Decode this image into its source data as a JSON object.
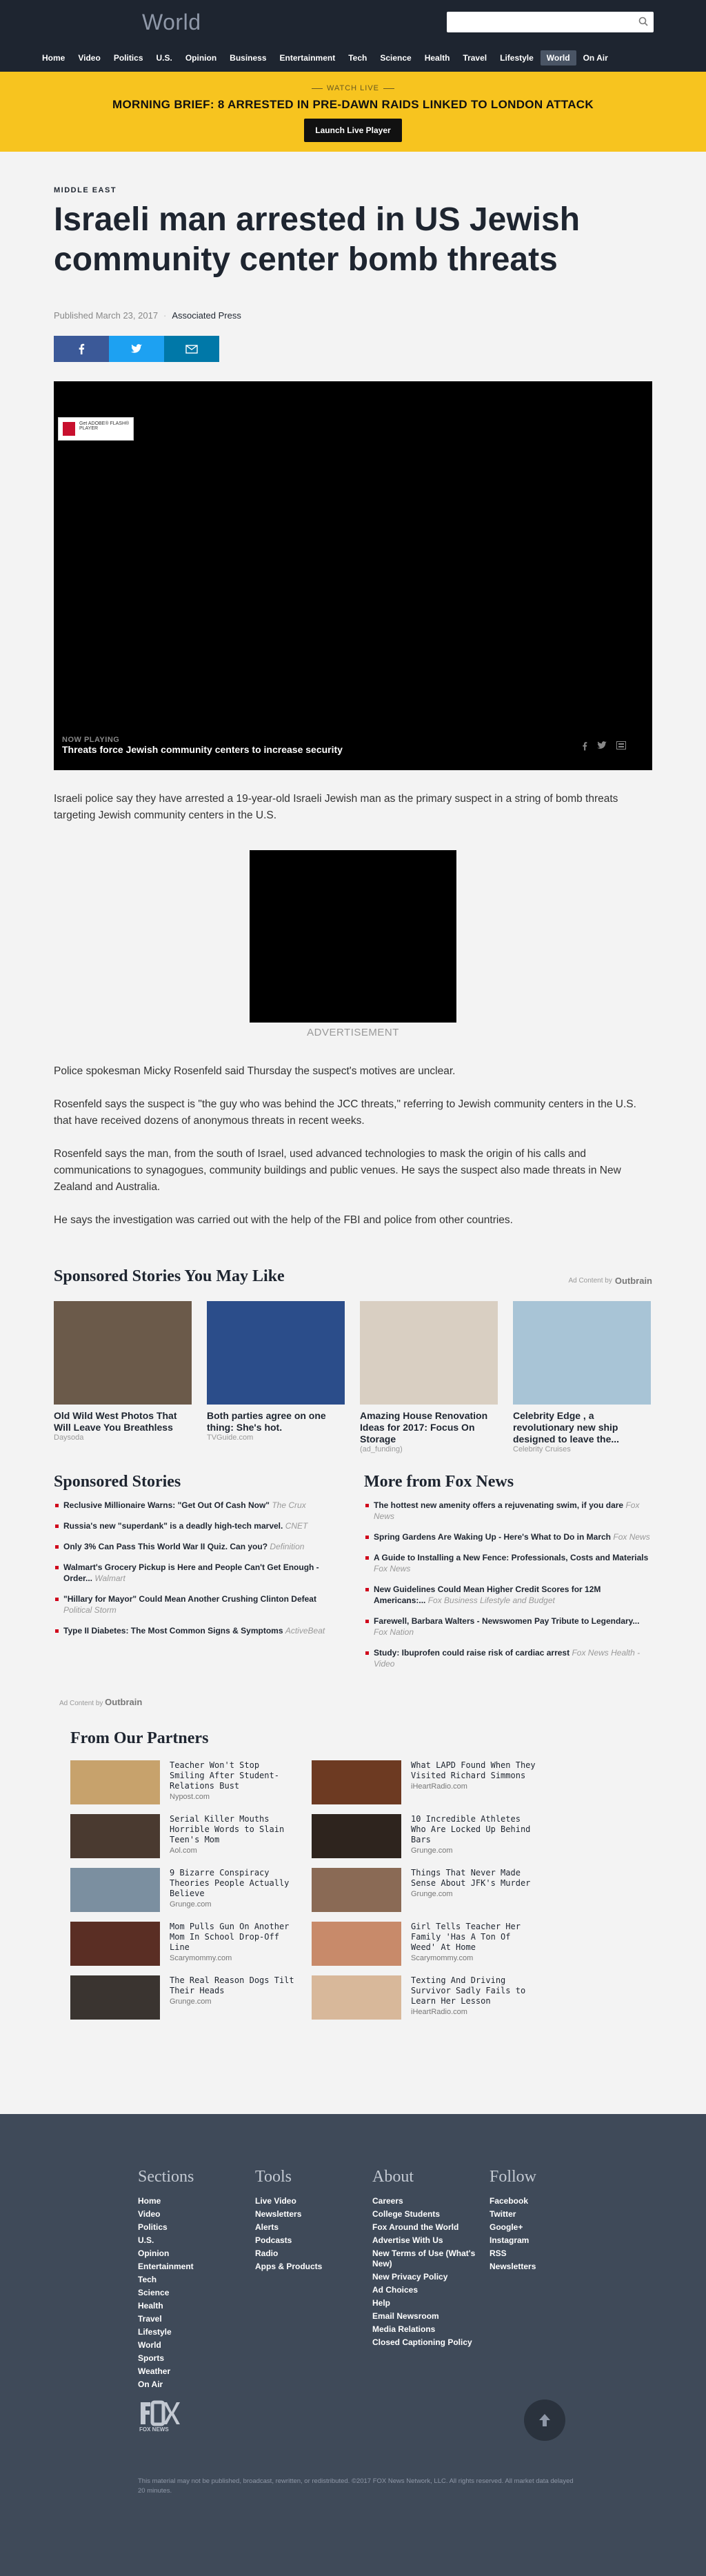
{
  "header": {
    "section_title": "World",
    "search_placeholder": "",
    "nav": [
      "Home",
      "Video",
      "Politics",
      "U.S.",
      "Opinion",
      "Business",
      "Entertainment",
      "Tech",
      "Science",
      "Health",
      "Travel",
      "Lifestyle",
      "World",
      "On Air"
    ],
    "active_nav": "World"
  },
  "watch_live": {
    "label": "WATCH LIVE",
    "headline": "MORNING BRIEF: 8 ARRESTED IN PRE-DAWN RAIDS LINKED TO LONDON ATTACK",
    "button": "Launch Live Player"
  },
  "article": {
    "kicker": "MIDDLE EAST",
    "headline": "Israeli man arrested in US Jewish community center bomb threats",
    "published": "Published March 23, 2017",
    "author": "Associated Press",
    "video": {
      "badge_text": "Get ADOBE® FLASH® PLAYER",
      "now_playing_label": "NOW PLAYING",
      "title": "Threats force Jewish community centers to increase security"
    },
    "paragraph_1": "Israeli police say they have arrested a 19-year-old Israeli Jewish man as the primary suspect in a string of bomb threats targeting Jewish community centers in the U.S.",
    "ad_label": "ADVERTISEMENT",
    "paragraph_2": "Police spokesman Micky Rosenfeld said Thursday the suspect's motives are unclear.",
    "paragraph_3": "Rosenfeld says the suspect is \"the guy who was behind the JCC threats,\" referring to Jewish community centers in the U.S. that have received dozens of anonymous threats in recent weeks.",
    "paragraph_4": "Rosenfeld says the man, from the south of Israel, used advanced technologies to mask the origin of his calls and communications to synagogues, community buildings and public venues. He says the suspect also made threats in New Zealand and Australia.",
    "paragraph_5": "He says the investigation was carried out with the help of the FBI and police from other countries."
  },
  "sponsored_grid": {
    "title": "Sponsored Stories You May Like",
    "ad_content": "Ad Content by",
    "outbrain": "Outbrain",
    "cards": [
      {
        "title": "Old Wild West Photos That Will Leave You Breathless",
        "source": "Daysoda",
        "color": "#6b5a4a"
      },
      {
        "title": "Both parties agree on one thing: She's hot.",
        "source": "TVGuide.com",
        "color": "#2b4d8a"
      },
      {
        "title": "Amazing House Renovation Ideas for 2017: Focus On Storage",
        "source": "(ad_funding)",
        "color": "#d9cfc2"
      },
      {
        "title": "Celebrity Edge , a revolutionary new ship designed to leave the...",
        "source": "Celebrity Cruises",
        "color": "#a8c4d6"
      }
    ]
  },
  "sponsored_list": {
    "title": "Sponsored Stories",
    "items": [
      {
        "text": "Reclusive Millionaire Warns: \"Get Out Of Cash Now\"",
        "source": "The Crux"
      },
      {
        "text": "Russia's new \"superdank\" is a deadly high-tech marvel.",
        "source": "CNET"
      },
      {
        "text": "Only 3% Can Pass This World War II Quiz. Can you?",
        "source": "Definition"
      },
      {
        "text": "Walmart's Grocery Pickup is Here and People Can't Get Enough - Order...",
        "source": "Walmart"
      },
      {
        "text": "\"Hillary for Mayor\" Could Mean Another Crushing Clinton Defeat",
        "source": "Political Storm"
      },
      {
        "text": "Type II Diabetes: The Most Common Signs & Symptoms",
        "source": "ActiveBeat"
      }
    ]
  },
  "more_from": {
    "title": "More from Fox News",
    "items": [
      {
        "text": "The hottest new amenity offers a rejuvenating swim, if you dare",
        "source": "Fox News"
      },
      {
        "text": "Spring Gardens Are Waking Up - Here's What to Do in March",
        "source": "Fox News"
      },
      {
        "text": "A Guide to Installing a New Fence: Professionals, Costs and Materials",
        "source": "Fox News"
      },
      {
        "text": "New Guidelines Could Mean Higher Credit Scores for 12M Americans:...",
        "source": "Fox Business Lifestyle and Budget"
      },
      {
        "text": "Farewell, Barbara Walters - Newswomen Pay Tribute to Legendary...",
        "source": "Fox Nation"
      },
      {
        "text": "Study: Ibuprofen could raise risk of cardiac arrest",
        "source": "Fox News Health - Video"
      }
    ],
    "ad_content": "Ad Content by"
  },
  "partners": {
    "title": "From Our Partners",
    "items": [
      {
        "title": "Teacher Won't Stop Smiling After Student-Relations Bust",
        "source": "Nypost.com",
        "color": "#c7a26c"
      },
      {
        "title": "What LAPD Found When They Visited Richard Simmons",
        "source": "iHeartRadio.com",
        "color": "#6d3a22"
      },
      {
        "title": "Serial Killer Mouths Horrible Words to Slain Teen's Mom",
        "source": "Aol.com",
        "color": "#4a3a30"
      },
      {
        "title": "10 Incredible Athletes Who Are Locked Up Behind Bars",
        "source": "Grunge.com",
        "color": "#2e241e"
      },
      {
        "title": "9 Bizarre Conspiracy Theories People Actually Believe",
        "source": "Grunge.com",
        "color": "#7b8fa0"
      },
      {
        "title": "Things That Never Made Sense About JFK's Murder",
        "source": "Grunge.com",
        "color": "#8a6a55"
      },
      {
        "title": "Mom Pulls Gun On Another Mom In School Drop-Off Line",
        "source": "Scarymommy.com",
        "color": "#5a2e24"
      },
      {
        "title": "Girl Tells Teacher Her Family 'Has A Ton Of Weed' At Home",
        "source": "Scarymommy.com",
        "color": "#c88a6a"
      },
      {
        "title": "The Real Reason Dogs Tilt Their Heads",
        "source": "Grunge.com",
        "color": "#3a3430"
      },
      {
        "title": "Texting And Driving Survivor Sadly Fails to Learn Her Lesson",
        "source": "iHeartRadio.com",
        "color": "#d8b89a"
      }
    ]
  },
  "footer": {
    "columns": [
      {
        "title": "Sections",
        "items": [
          "Home",
          "Video",
          "Politics",
          "U.S.",
          "Opinion",
          "Entertainment",
          "Tech",
          "Science",
          "Health",
          "Travel",
          "Lifestyle",
          "World",
          "Sports",
          "Weather",
          "On Air"
        ]
      },
      {
        "title": "Tools",
        "items": [
          "Live Video",
          "Newsletters",
          "Alerts",
          "Podcasts",
          "Radio",
          "Apps & Products"
        ]
      },
      {
        "title": "About",
        "items": [
          "Careers",
          "College Students",
          "Fox Around the World",
          "Advertise With Us",
          "New Terms of Use (What's New)",
          "New Privacy Policy",
          "Ad Choices",
          "Help",
          "Email Newsroom",
          "Media Relations",
          "Closed Captioning Policy"
        ]
      },
      {
        "title": "Follow",
        "items": [
          "Facebook",
          "Twitter",
          "Google+",
          "Instagram",
          "RSS",
          "Newsletters"
        ]
      }
    ],
    "logo_text": "FOX NEWS",
    "legal": "This material may not be published, broadcast, rewritten, or redistributed. ©2017 FOX News Network, LLC. All rights reserved. All market data delayed 20 minutes."
  },
  "colors": {
    "header_bg": "#1e2530",
    "watch_bg": "#f7c41f",
    "footer_bg": "#3f4a59",
    "accent": "#d0021b"
  }
}
